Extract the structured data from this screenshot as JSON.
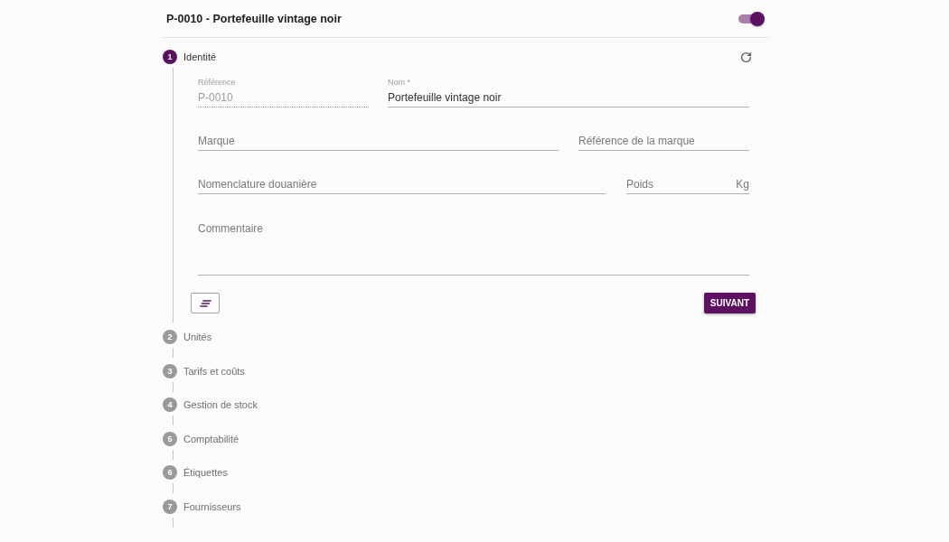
{
  "header": {
    "title": "P-0010 - Portefeuille vintage noir",
    "toggle": {
      "on": true
    }
  },
  "steps": [
    {
      "number": "1",
      "label": "Identité",
      "selected": true,
      "form": {
        "rows": [
          [
            {
              "kind": "text",
              "label": "Référence",
              "value": "P-0010",
              "disabled": true
            },
            {
              "kind": "text",
              "label": "Nom *",
              "value": "Portefeuille vintage noir",
              "disabled": false
            }
          ],
          [
            {
              "kind": "text",
              "placeholder": "Marque",
              "disabled": false
            },
            {
              "kind": "text",
              "placeholder": "Référence de la marque",
              "disabled": false
            }
          ],
          [
            {
              "kind": "text",
              "placeholder": "Nomenclature douanière",
              "disabled": false
            },
            {
              "kind": "text",
              "placeholder": "Poids",
              "suffix": "Kg",
              "disabled": false
            }
          ],
          [
            {
              "kind": "textarea",
              "placeholder": "Commentaire",
              "disabled": false
            }
          ]
        ],
        "next_button": {
          "label": "SUIVANT"
        }
      }
    },
    {
      "number": "2",
      "label": "Unités",
      "selected": false
    },
    {
      "number": "3",
      "label": "Tarifs et coûts",
      "selected": false
    },
    {
      "number": "4",
      "label": "Gestion de stock",
      "selected": false
    },
    {
      "number": "5",
      "label": "Comptabilité",
      "selected": false
    },
    {
      "number": "6",
      "label": "Étiquettes",
      "selected": false
    },
    {
      "number": "7",
      "label": "Fournisseurs",
      "selected": false
    }
  ]
}
